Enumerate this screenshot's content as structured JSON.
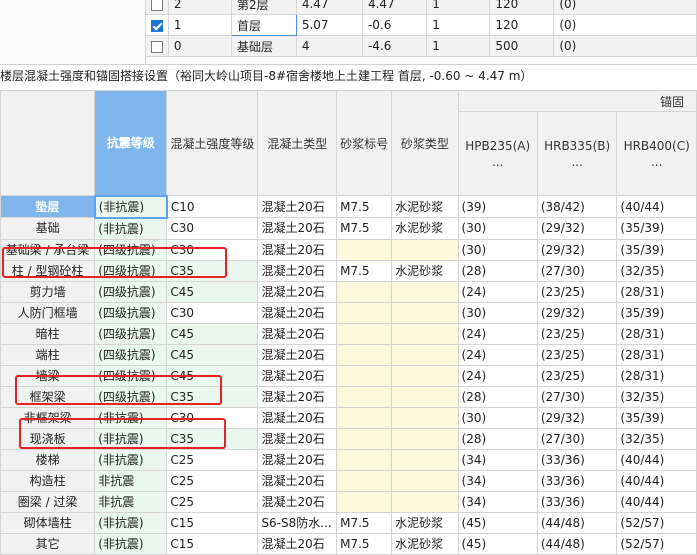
{
  "floors": {
    "rows": [
      {
        "checked": false,
        "num": "2",
        "name": "第2层",
        "height": "4.47",
        "bottom": "4.47",
        "count": "1",
        "slab": "120",
        "area": "(0)"
      },
      {
        "checked": true,
        "num": "1",
        "name": "首层",
        "height": "5.07",
        "bottom": "-0.6",
        "count": "1",
        "slab": "120",
        "area": "(0)"
      },
      {
        "checked": false,
        "num": "0",
        "name": "基础层",
        "height": "4",
        "bottom": "-4.6",
        "count": "1",
        "slab": "500",
        "area": "(0)"
      }
    ]
  },
  "title": "楼层混凝土强度和锚固搭接设置（裕同大岭山项目-8#宿舍楼地上土建工程  首层, -0.60 ~ 4.47 m）",
  "grid": {
    "anchor_group": "锚固",
    "headers": {
      "seismic": "抗震等级",
      "concrete_grade": "混凝土强度等级",
      "concrete_type": "混凝土类型",
      "mortar_grade": "砂浆标号",
      "mortar_type": "砂浆类型",
      "hpb235": "HPB235(A)",
      "hrb335": "HRB335(B)",
      "hrb400": "HRB400(C)",
      "ellipsis": "..."
    },
    "rows": [
      {
        "name": "垫层",
        "seismic": "(非抗震)",
        "grade": "C10",
        "ctype": "混凝土20石",
        "mgrade": "M7.5",
        "mtype": "水泥砂浆",
        "a": "(39)",
        "b": "(38/42)",
        "c": "(40/44)"
      },
      {
        "name": "基础",
        "seismic": "(非抗震)",
        "grade": "C30",
        "ctype": "混凝土20石",
        "mgrade": "M7.5",
        "mtype": "水泥砂浆",
        "a": "(30)",
        "b": "(29/32)",
        "c": "(35/39)"
      },
      {
        "name": "基础梁 / 承台梁",
        "seismic": "(四级抗震)",
        "grade": "C30",
        "ctype": "混凝土20石",
        "mgrade": "",
        "mtype": "",
        "a": "(30)",
        "b": "(29/32)",
        "c": "(35/39)"
      },
      {
        "name": "柱 / 型钢砼柱",
        "seismic": "(四级抗震)",
        "grade": "C35",
        "ctype": "混凝土20石",
        "mgrade": "M7.5",
        "mtype": "水泥砂浆",
        "a": "(28)",
        "b": "(27/30)",
        "c": "(32/35)"
      },
      {
        "name": "剪力墙",
        "seismic": "(四级抗震)",
        "grade": "C45",
        "ctype": "混凝土20石",
        "mgrade": "",
        "mtype": "",
        "a": "(24)",
        "b": "(23/25)",
        "c": "(28/31)"
      },
      {
        "name": "人防门框墙",
        "seismic": "(四级抗震)",
        "grade": "C30",
        "ctype": "混凝土20石",
        "mgrade": "",
        "mtype": "",
        "a": "(30)",
        "b": "(29/32)",
        "c": "(35/39)"
      },
      {
        "name": "暗柱",
        "seismic": "(四级抗震)",
        "grade": "C45",
        "ctype": "混凝土20石",
        "mgrade": "",
        "mtype": "",
        "a": "(24)",
        "b": "(23/25)",
        "c": "(28/31)"
      },
      {
        "name": "端柱",
        "seismic": "(四级抗震)",
        "grade": "C45",
        "ctype": "混凝土20石",
        "mgrade": "",
        "mtype": "",
        "a": "(24)",
        "b": "(23/25)",
        "c": "(28/31)"
      },
      {
        "name": "墙梁",
        "seismic": "(四级抗震)",
        "grade": "C45",
        "ctype": "混凝土20石",
        "mgrade": "",
        "mtype": "",
        "a": "(24)",
        "b": "(23/25)",
        "c": "(28/31)"
      },
      {
        "name": "框架梁",
        "seismic": "(四级抗震)",
        "grade": "C35",
        "ctype": "混凝土20石",
        "mgrade": "",
        "mtype": "",
        "a": "(28)",
        "b": "(27/30)",
        "c": "(32/35)"
      },
      {
        "name": "非框架梁",
        "seismic": "(非抗震)",
        "grade": "C30",
        "ctype": "混凝土20石",
        "mgrade": "",
        "mtype": "",
        "a": "(30)",
        "b": "(29/32)",
        "c": "(35/39)"
      },
      {
        "name": "现浇板",
        "seismic": "(非抗震)",
        "grade": "C35",
        "ctype": "混凝土20石",
        "mgrade": "",
        "mtype": "",
        "a": "(28)",
        "b": "(27/30)",
        "c": "(32/35)"
      },
      {
        "name": "楼梯",
        "seismic": "(非抗震)",
        "grade": "C25",
        "ctype": "混凝土20石",
        "mgrade": "",
        "mtype": "",
        "a": "(34)",
        "b": "(33/36)",
        "c": "(40/44)"
      },
      {
        "name": "构造柱",
        "seismic": "非抗震",
        "grade": "C25",
        "ctype": "混凝土20石",
        "mgrade": "",
        "mtype": "",
        "a": "(34)",
        "b": "(33/36)",
        "c": "(40/44)"
      },
      {
        "name": "圈梁 / 过梁",
        "seismic": "非抗震",
        "grade": "C25",
        "ctype": "混凝土20石",
        "mgrade": "",
        "mtype": "",
        "a": "(34)",
        "b": "(33/36)",
        "c": "(40/44)"
      },
      {
        "name": "砌体墙柱",
        "seismic": "(非抗震)",
        "grade": "C15",
        "ctype": "S6-S8防水...",
        "mgrade": "M7.5",
        "mtype": "水泥砂浆",
        "a": "(45)",
        "b": "(44/48)",
        "c": "(52/57)"
      },
      {
        "name": "其它",
        "seismic": "(非抗震)",
        "grade": "C15",
        "ctype": "混凝土20石",
        "mgrade": "M7.5",
        "mtype": "水泥砂浆",
        "a": "(45)",
        "b": "(44/48)",
        "c": "(52/57)"
      }
    ]
  },
  "colors": {
    "accent": "#7fb6ec",
    "highlight_box": "#e5231f",
    "green_cell": "#e9f7ef",
    "yellow_cell": "#fdf9dc"
  }
}
